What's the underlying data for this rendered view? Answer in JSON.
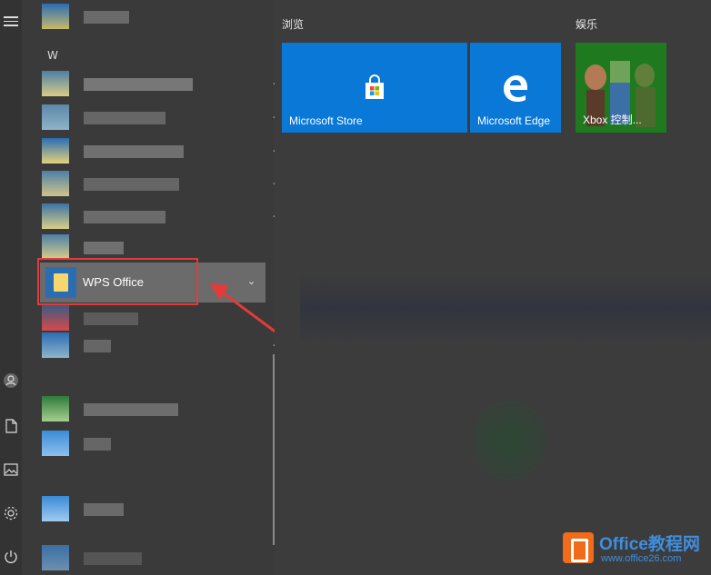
{
  "left_rail": {
    "icons": [
      "menu-icon",
      "user-icon",
      "document-icon",
      "pictures-icon",
      "settings-icon",
      "power-icon"
    ]
  },
  "app_list": {
    "letter_header": "W",
    "highlighted_app": {
      "label": "WPS Office"
    }
  },
  "tiles": {
    "groups": [
      {
        "title": "浏览"
      },
      {
        "title": "娱乐"
      }
    ],
    "items": [
      {
        "label": "Microsoft Store",
        "icon": "store-bag-icon"
      },
      {
        "label": "Microsoft Edge",
        "icon": "edge-icon"
      },
      {
        "label": "Xbox 控制...",
        "icon": "xbox-characters-image"
      }
    ]
  },
  "colors": {
    "tile_blue": "#0a78d7",
    "highlight_red": "#e33b3b",
    "wps_blue": "#2a6db3"
  },
  "watermark": {
    "title": "Office教程网",
    "url": "www.office26.com"
  }
}
